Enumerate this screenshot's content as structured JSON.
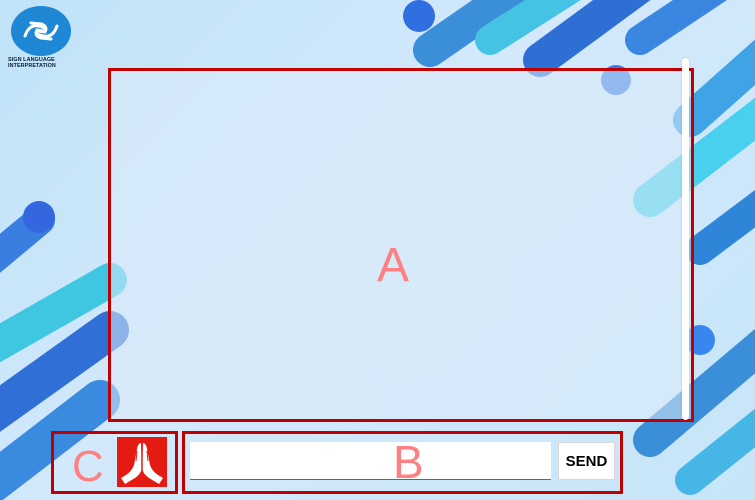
{
  "logo": {
    "icon": "sign-language-icon",
    "text_line1": "SIGN LANGUAGE",
    "text_line2": "INTERPRETATION"
  },
  "regions": {
    "a_label": "A",
    "b_label": "B",
    "c_label": "C"
  },
  "composer": {
    "input_value": "",
    "input_placeholder": "",
    "send_label": "SEND"
  },
  "sign_button": {
    "icon": "praying-hands-icon"
  },
  "colors": {
    "region_border": "#c00000",
    "region_letter": "#ff8080",
    "sign_button_bg": "#e31b12",
    "logo_blue": "#1e88d6",
    "accent_blue": "#2f7fe0",
    "accent_cyan": "#3fc6e8"
  }
}
